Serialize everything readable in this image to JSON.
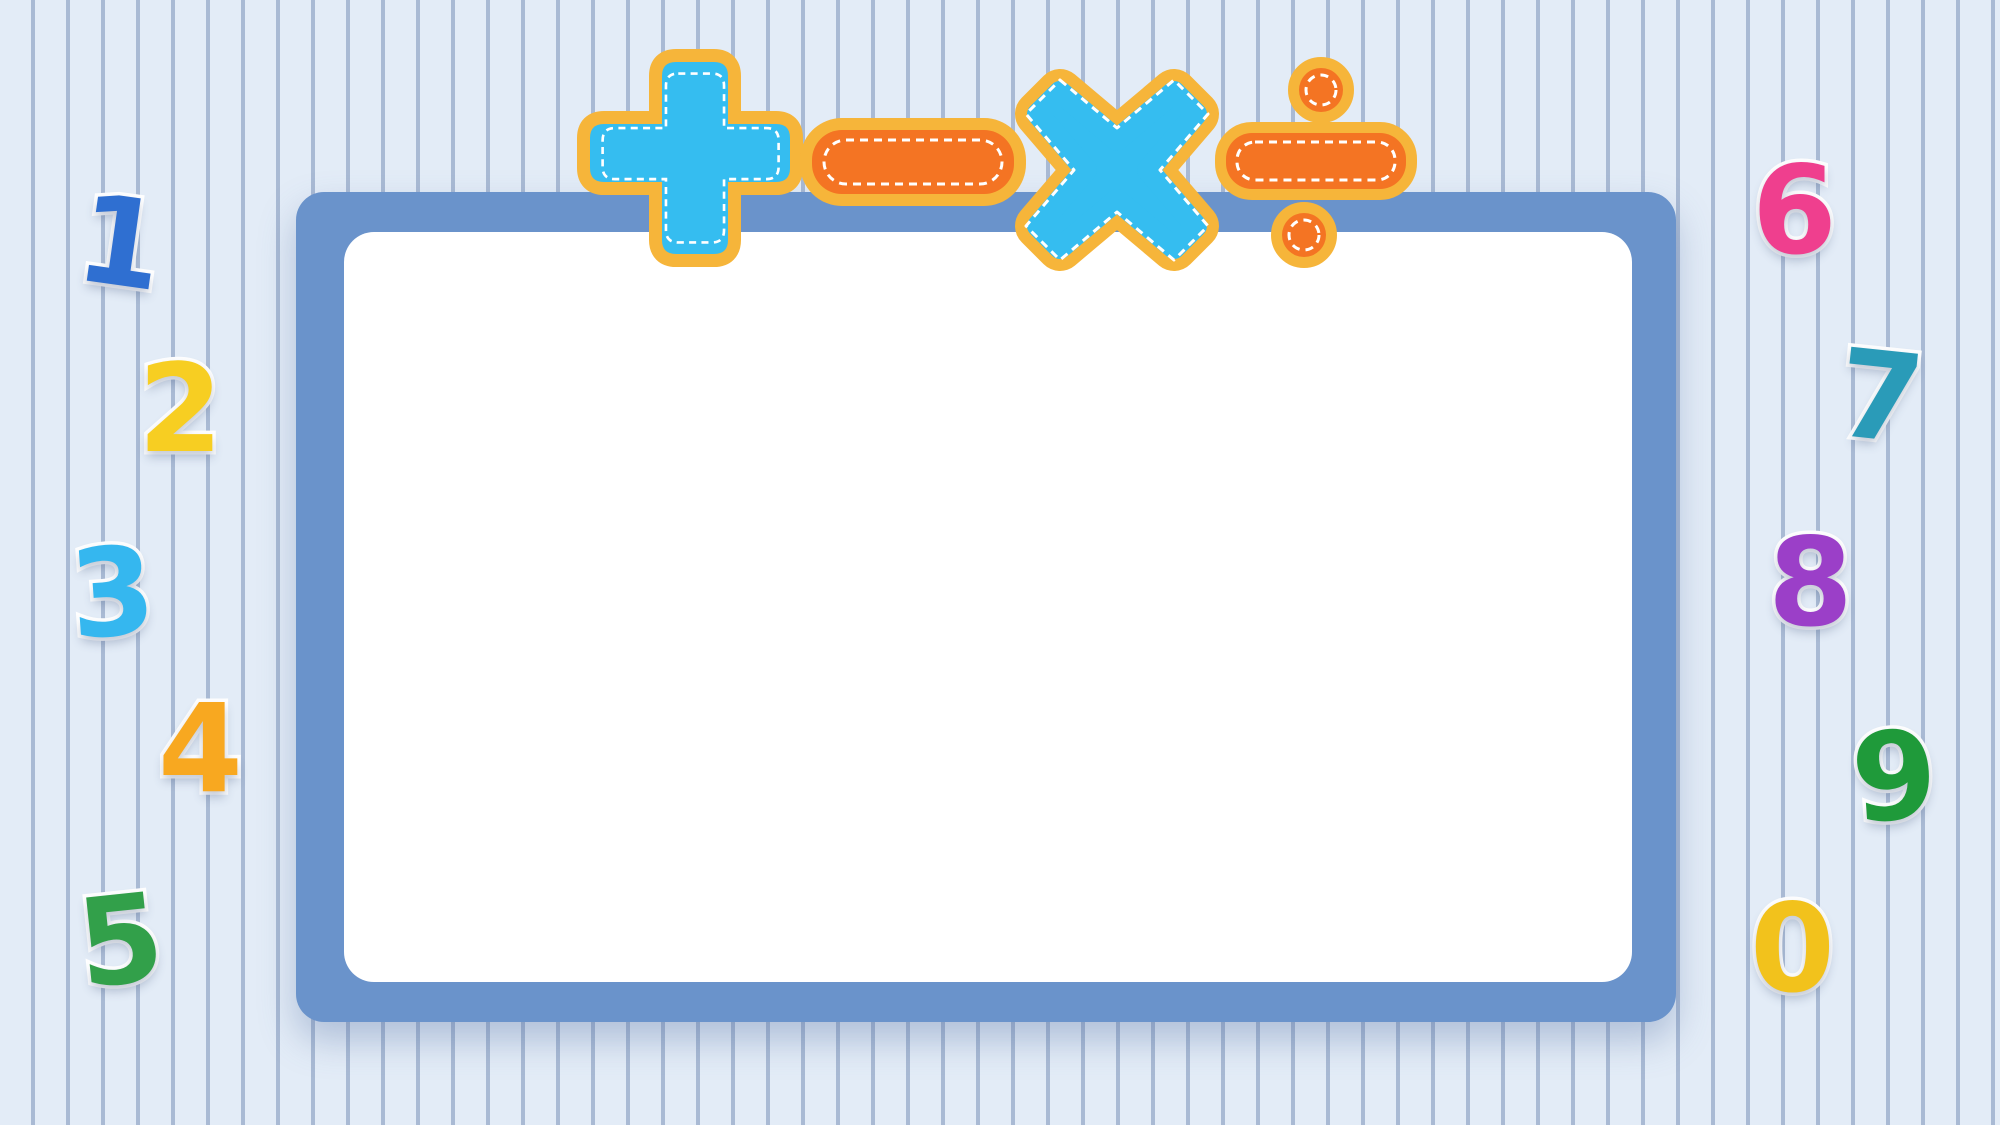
{
  "board": {
    "frame_color": "#6a93cb",
    "inner_color": "#ffffff"
  },
  "operators": [
    {
      "name": "plus",
      "icon": "plus-icon",
      "color": "#35bdf0"
    },
    {
      "name": "minus",
      "icon": "minus-icon",
      "color": "#f47423"
    },
    {
      "name": "times",
      "icon": "times-icon",
      "color": "#35bdf0"
    },
    {
      "name": "divide",
      "icon": "divide-icon",
      "color": "#f47423"
    }
  ],
  "operator_outline_color": "#f6b53a",
  "operator_stitch_color": "#ffffff",
  "digits_left": [
    {
      "value": "1",
      "color": "#2f6fd1"
    },
    {
      "value": "2",
      "color": "#f7ce22"
    },
    {
      "value": "3",
      "color": "#35b7ef"
    },
    {
      "value": "4",
      "color": "#f8a820"
    },
    {
      "value": "5",
      "color": "#32a04a"
    }
  ],
  "digits_right": [
    {
      "value": "6",
      "color": "#ef3f8e"
    },
    {
      "value": "7",
      "color": "#2a9bb8"
    },
    {
      "value": "8",
      "color": "#9b3fc8"
    },
    {
      "value": "9",
      "color": "#1f9a3a"
    },
    {
      "value": "0",
      "color": "#f2c21c"
    }
  ]
}
